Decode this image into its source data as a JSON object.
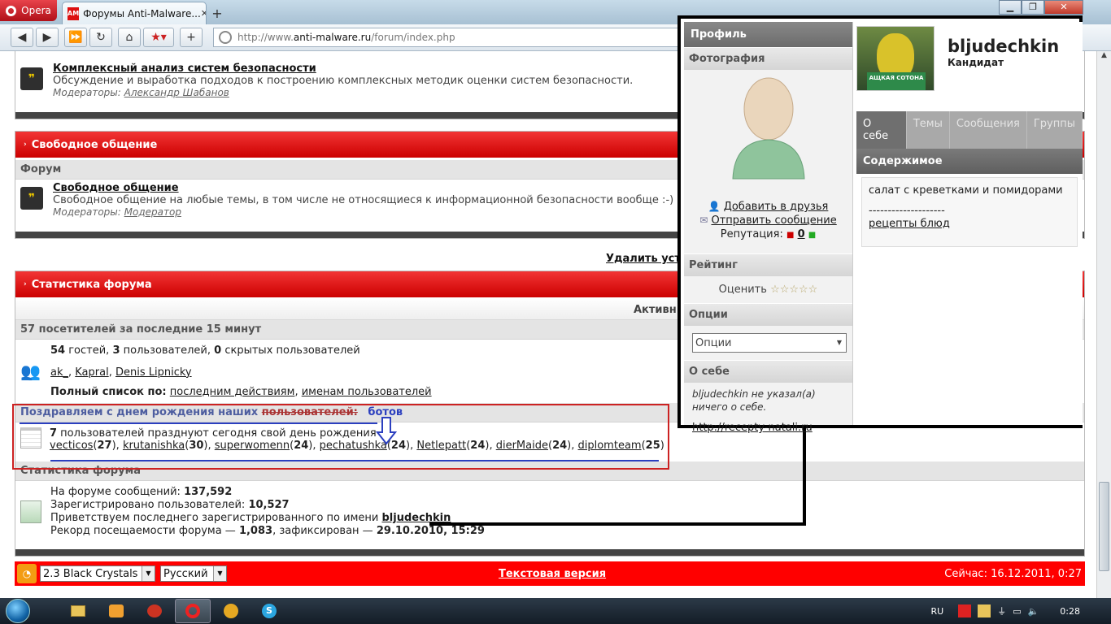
{
  "browser": {
    "menu_label": "Opera",
    "tab_title": "Форумы Anti-Malware...",
    "tab_favicon": "AM",
    "url_prefix": "http://www.",
    "url_domain": "anti-malware.ru",
    "url_path": "/forum/index.php"
  },
  "forum": {
    "complex": {
      "title": "Комплексный анализ систем безопасности",
      "desc": "Обсуждение и выработка подходов к построению комплексных методик оценки систем безопасности.",
      "mods_label": "Модераторы:",
      "mod": "Александр Шабанов"
    },
    "free_section": {
      "header": "Свободное общение",
      "col_header": "Форум",
      "title": "Свободное общение",
      "desc": "Свободное общение на любые темы, в том числе не относящиеся к информационной безопасности вообще :-)",
      "mods_label": "Модераторы:",
      "mod": "Модератор"
    },
    "delete_cookies": "Удалить уста",
    "stats": {
      "header": "Статистика форума",
      "active_label": "Активн",
      "visitors_header": "57 посетителей за последние 15 минут",
      "guests_n": "54",
      "guests_t": " гостей, ",
      "users_n": "3",
      "users_t": " пользователей, ",
      "hidden_n": "0",
      "hidden_t": " скрытых пользователей",
      "online_users": [
        "ak_",
        "Kapral",
        "Denis Lipnicky"
      ],
      "full_list_label": "Полный список по:",
      "full_list_by_action": "последним действиям",
      "full_list_by_name": "именам пользователей",
      "birthday_header": "Поздравляем с днем рождения наших",
      "birthday_strike": "пользователей:",
      "birthday_bots": "ботов",
      "birthday_count": "7",
      "birthday_text": " пользователей празднуют сегодня свой день рождения",
      "birthdays": [
        {
          "name": "vecticos",
          "age": "27"
        },
        {
          "name": "krutanishka",
          "age": "30"
        },
        {
          "name": "superwomenn",
          "age": "24"
        },
        {
          "name": "pechatushka",
          "age": "24"
        },
        {
          "name": "Netlepatt",
          "age": "24"
        },
        {
          "name": "dierMaide",
          "age": "24"
        },
        {
          "name": "diplomteam",
          "age": "25"
        }
      ],
      "stat_header": "Статистика форума",
      "posts_label": "На форуме сообщений: ",
      "posts_value": "137,592",
      "registered_label": "Зарегистрировано пользователей: ",
      "registered_value": "10,527",
      "welcome_label": "Приветствуем последнего зарегистрированного по имени ",
      "welcome_user": "bljudechkin",
      "record_label": "Рекорд посещаемости форума — ",
      "record_value": "1,083",
      "record_mid": ", зафиксирован — ",
      "record_date": "29.10.2010, 15:29"
    },
    "footer": {
      "skin": "2.3 Black Crystals",
      "language": "Русский",
      "text_version": "Текстовая версия",
      "now": "Сейчас: 16.12.2011, 0:27"
    }
  },
  "profile": {
    "header": "Профиль",
    "photo_header": "Фотография",
    "add_friend": "Добавить в друзья",
    "send_message": "Отправить сообщение",
    "reputation_label": "Репутация:",
    "reputation_value": "0",
    "rating_header": "Рейтинг",
    "rate_label": "Оценить",
    "rate_stars": "☆☆☆☆☆",
    "options_header": "Опции",
    "options_select": "Опции",
    "about_header": "О себе",
    "about_text": "bljudechkin не указал(а) ничего о себе.",
    "about_link": "http://recepty-natali.ru",
    "username": "bljudechkin",
    "rank": "Кандидат",
    "photo_caption": "АЩКАЯ СОТОНА",
    "tabs": [
      "О себе",
      "Темы",
      "Сообщения",
      "Группы"
    ],
    "content_header": "Содержимое",
    "content_text": "салат с креветками и помидорами",
    "content_sep": "--------------------",
    "content_link": "рецепты блюд"
  },
  "taskbar": {
    "lang": "RU",
    "clock": "0:28"
  },
  "colors": {
    "forum_red": "#e60000",
    "annotation_red": "#cc2222",
    "annotation_blue": "#2b3fbf"
  }
}
